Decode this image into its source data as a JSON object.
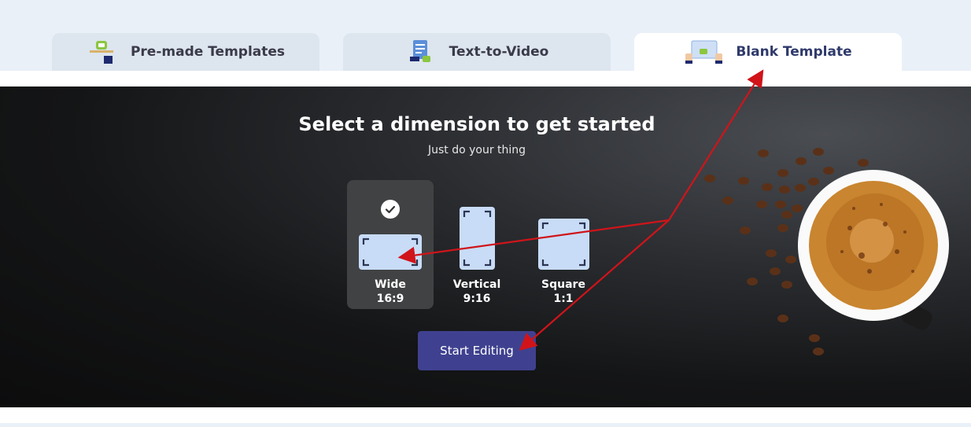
{
  "tabs": [
    {
      "label": "Pre-made Templates",
      "icon": "template-screen-icon",
      "active": false
    },
    {
      "label": "Text-to-Video",
      "icon": "document-video-icon",
      "active": false
    },
    {
      "label": "Blank Template",
      "icon": "blank-canvas-icon",
      "active": true
    }
  ],
  "hero": {
    "title": "Select a dimension to get started",
    "subtitle": "Just do your thing"
  },
  "dimensions": [
    {
      "label": "Wide",
      "ratio": "16:9",
      "selected": true,
      "icon": "wide-frame-icon"
    },
    {
      "label": "Vertical",
      "ratio": "9:16",
      "selected": false,
      "icon": "vertical-frame-icon"
    },
    {
      "label": "Square",
      "ratio": "1:1",
      "selected": false,
      "icon": "square-frame-icon"
    }
  ],
  "start_button": {
    "label": "Start Editing"
  },
  "colors": {
    "page_bg": "#e9f0f8",
    "tab_bg": "#dde5ee",
    "tab_active_bg": "#ffffff",
    "button_bg": "#3f4190",
    "frame_fill": "#c8dcf7",
    "annotation_arrow": "#d0141a"
  }
}
